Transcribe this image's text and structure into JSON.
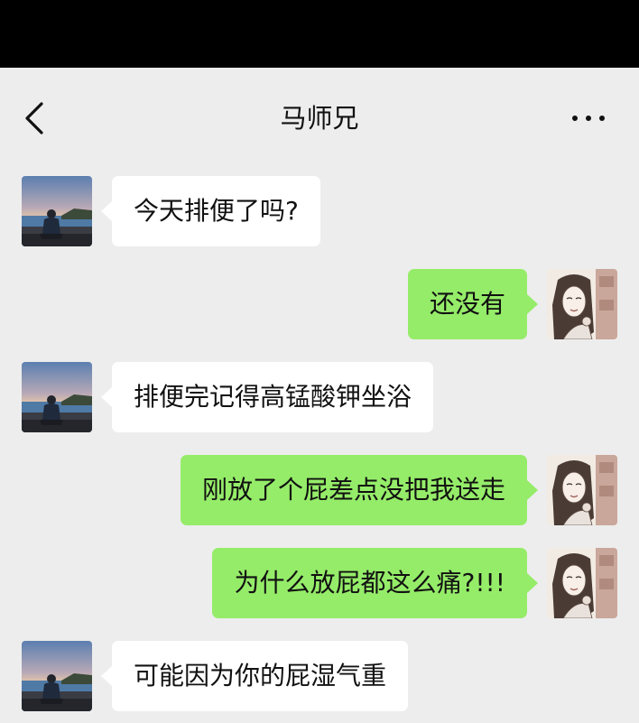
{
  "header": {
    "title": "马师兄",
    "back_icon": "chevron-left-icon",
    "more_icon": "more-dots-icon"
  },
  "contacts": {
    "other": {
      "name": "马师兄",
      "avatar": "man-sitting-by-sea-avatar"
    },
    "me": {
      "avatar": "woman-portrait-avatar"
    }
  },
  "colors": {
    "status_bar": "#000000",
    "background": "#ededed",
    "incoming_bubble": "#ffffff",
    "outgoing_bubble": "#95ec69",
    "text": "#111111"
  },
  "messages": [
    {
      "from": "other",
      "text": "今天排便了吗?"
    },
    {
      "from": "me",
      "text": "还没有"
    },
    {
      "from": "other",
      "text": "排便完记得高锰酸钾坐浴"
    },
    {
      "from": "me",
      "text": "刚放了个屁差点没把我送走"
    },
    {
      "from": "me",
      "text": "为什么放屁都这么痛?!!!"
    },
    {
      "from": "other",
      "text": "可能因为你的屁湿气重"
    }
  ]
}
